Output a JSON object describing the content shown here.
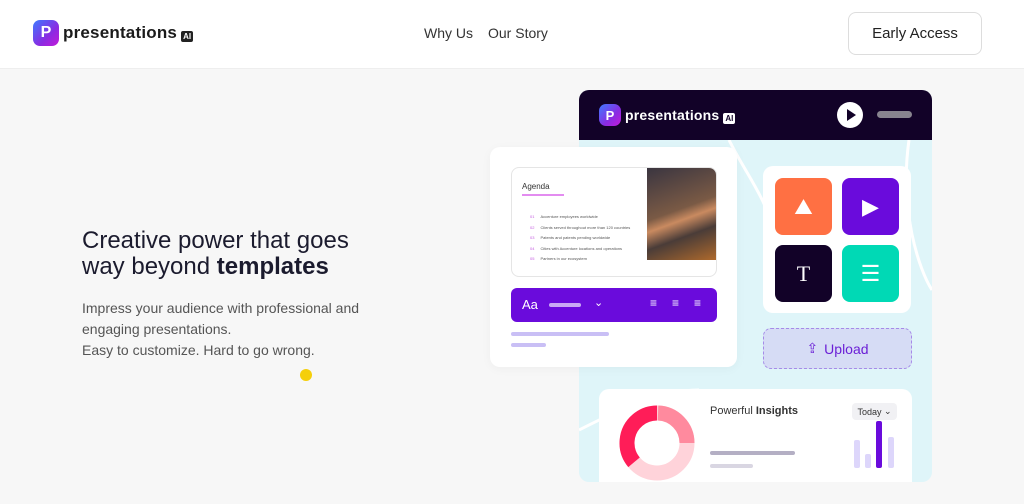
{
  "header": {
    "logo_text": "presentations",
    "logo_badge": "AI",
    "nav": [
      {
        "label": "Why Us"
      },
      {
        "label": "Our Story"
      }
    ],
    "cta": "Early Access"
  },
  "hero": {
    "title_pre": "Creative power that goes way beyond ",
    "title_bold": "templates",
    "lines": [
      "Impress your audience with professional and engaging presentations.",
      "Easy to customize. Hard to go wrong."
    ]
  },
  "mock": {
    "logo_text": "presentations",
    "logo_badge": "AI",
    "slide": {
      "title": "Agenda",
      "items": [
        {
          "n": "01",
          "t": "Accenture employees worldwide"
        },
        {
          "n": "02",
          "t": "Clients served throughout more than 120 countries"
        },
        {
          "n": "03",
          "t": "Patents and patents pending worldwide"
        },
        {
          "n": "04",
          "t": "Cities with Accenture locations and operations"
        },
        {
          "n": "05",
          "t": "Partners in our ecosystem"
        }
      ]
    },
    "toolbar": {
      "font_label": "Aa"
    },
    "tiles": [
      {
        "icon": "image-icon",
        "color": "#ff7043"
      },
      {
        "icon": "video-icon",
        "color": "#6a0bdc"
      },
      {
        "icon": "text-icon",
        "color": "#120228"
      },
      {
        "icon": "comment-icon",
        "color": "#00d9b5"
      }
    ],
    "upload": "Upload",
    "insights": {
      "title_pre": "Powerful ",
      "title_bold": "Insights",
      "filter": "Today"
    }
  },
  "colors": {
    "accent": "#6a0bdc",
    "dark": "#120228",
    "highlight": "#f5cf0b"
  }
}
